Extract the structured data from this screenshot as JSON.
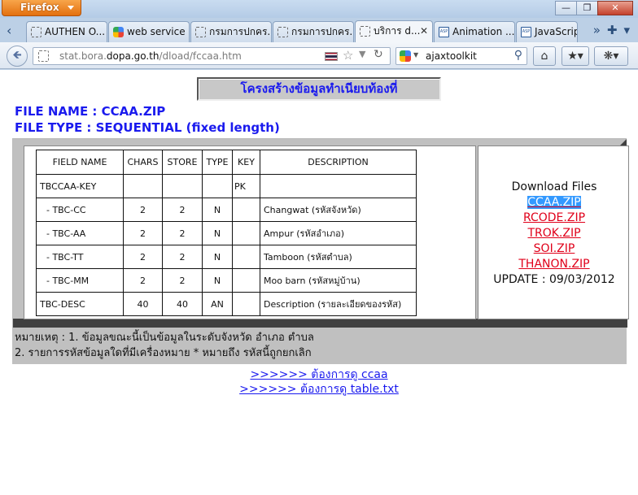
{
  "browser": {
    "app_button": "Firefox",
    "tabs": [
      {
        "label": "AUTHEN O...",
        "icon": "page-icon"
      },
      {
        "label": "web service ...",
        "icon": "google-icon"
      },
      {
        "label": "กรมการปกคร...",
        "icon": "page-icon"
      },
      {
        "label": "กรมการปกคร...",
        "icon": "page-icon"
      },
      {
        "label": "บริการ d...",
        "icon": "page-icon",
        "active": true
      },
      {
        "label": "Animation ...",
        "icon": "aspnet-icon"
      },
      {
        "label": "JavaScript",
        "icon": "aspnet-icon"
      }
    ],
    "url_prefix": "stat.bora.",
    "url_domain": "dopa.go.th",
    "url_path": "/dload/fccaa.htm",
    "search_value": "ajaxtoolkit"
  },
  "page": {
    "title": "โครงสร้างข้อมูลทำเนียบท้องที่",
    "file_name": "FILE NAME : CCAA.ZIP",
    "file_type": "FILE TYPE : SEQUENTIAL (fixed length)",
    "table": {
      "headers": {
        "name": "FIELD NAME",
        "chars": "CHARS",
        "store": "STORE",
        "type": "TYPE",
        "key": "KEY",
        "desc": "DESCRIPTION"
      },
      "rows": [
        {
          "name": "TBCCAA-KEY",
          "chars": "",
          "store": "",
          "type": "",
          "key": "PK",
          "desc": ""
        },
        {
          "name": "- TBC-CC",
          "chars": "2",
          "store": "2",
          "type": "N",
          "key": "",
          "desc": "Changwat (รหัสจังหวัด)"
        },
        {
          "name": "- TBC-AA",
          "chars": "2",
          "store": "2",
          "type": "N",
          "key": "",
          "desc": "Ampur (รหัสอำเภอ)"
        },
        {
          "name": "- TBC-TT",
          "chars": "2",
          "store": "2",
          "type": "N",
          "key": "",
          "desc": "Tamboon (รหัสตำบล)"
        },
        {
          "name": "- TBC-MM",
          "chars": "2",
          "store": "2",
          "type": "N",
          "key": "",
          "desc": "Moo barn (รหัสหมู่บ้าน)"
        },
        {
          "name": "TBC-DESC",
          "chars": "40",
          "store": "40",
          "type": "AN",
          "key": "",
          "desc": "Description (รายละเอียดของรหัส)"
        }
      ]
    },
    "downloads": {
      "title": "Download Files",
      "links": [
        "CCAA.ZIP",
        "RCODE.ZIP",
        "TROK.ZIP",
        "SOI.ZIP",
        "THANON.ZIP"
      ],
      "update": "UPDATE : 09/03/2012"
    },
    "notes": [
      "หมายเหตุ : 1. ข้อมูลขณะนี้เป็นข้อมูลในระดับจังหวัด อำเภอ ตำบล",
      "2. รายการรหัสข้อมูลใดที่มีเครื่องหมาย * หมายถึง รหัสนี้ถูกยกเลิก"
    ],
    "bottom_links": [
      ">>>>>> ต้องการดู ccaa",
      ">>>>>> ต้องการดู table.txt"
    ]
  }
}
